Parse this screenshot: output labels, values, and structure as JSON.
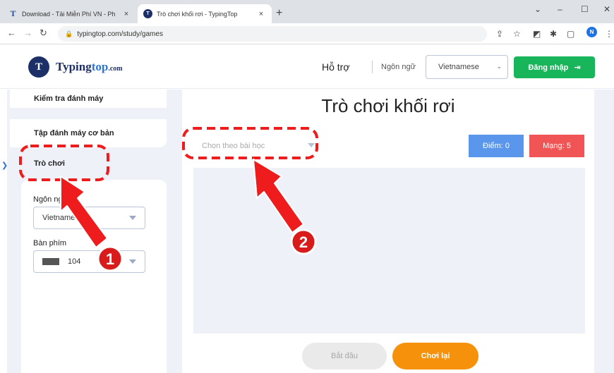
{
  "browser": {
    "tabs": [
      {
        "favicon": "T",
        "title": "Download - Tải Miễn Phí VN - Ph",
        "close": "×"
      },
      {
        "favicon": "T",
        "title": "Trò chơi khối rơi - TypingTop",
        "close": "×"
      }
    ],
    "new_tab": "+",
    "url": "typingtop.com/study/games",
    "profile_initial": "N"
  },
  "header": {
    "logo_mark": "T",
    "logo_brand": "Typing",
    "logo_brand_accent": "top",
    "logo_suffix": ".com",
    "nav_support": "Hỗ trợ",
    "nav_language": "Ngôn ngữ",
    "language_value": "Vietnamese",
    "login_label": "Đăng nhập",
    "login_icon": "⇥"
  },
  "sidebar": {
    "items": [
      {
        "label": "Kiểm tra đánh máy"
      },
      {
        "label": "Tập đánh máy cơ bản"
      },
      {
        "label": "Trò chơi"
      }
    ],
    "language_label": "Ngôn ngữ",
    "language_value": "Vietnamese",
    "keyboard_label": "Bàn phím",
    "keyboard_value": "104"
  },
  "main": {
    "title": "Trò chơi khối rơi",
    "lesson_placeholder": "Chọn theo bài học",
    "score_label": "Điểm: 0",
    "lives_label": "Mạng: 5",
    "start_label": "Bắt đầu",
    "replay_label": "Chơi lại"
  },
  "annotations": {
    "badge_1": "1",
    "badge_2": "2",
    "accent_color": "#ee1c1c"
  }
}
